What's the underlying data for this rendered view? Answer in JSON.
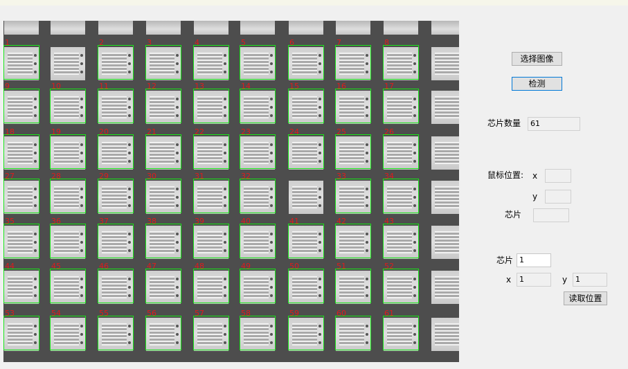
{
  "controls": {
    "select_image_label": "选择图像",
    "detect_label": "检测",
    "chip_count_label": "芯片数量",
    "chip_count_value": "61",
    "mouse_position_label": "鼠标位置:",
    "mouse_x_label": "x",
    "mouse_x_value": "",
    "mouse_y_label": "y",
    "mouse_y_value": "",
    "mouse_chip_label": "芯片",
    "mouse_chip_value": "",
    "query_chip_label": "芯片",
    "query_chip_value": "1",
    "read_x_label": "x",
    "read_x_value": "1",
    "read_y_label": "y",
    "read_y_value": "1",
    "read_position_label": "读取位置"
  },
  "detections": [
    {
      "label": "1",
      "row": 0,
      "col": 0
    },
    {
      "label": "2",
      "row": 0,
      "col": 2
    },
    {
      "label": "3",
      "row": 0,
      "col": 3
    },
    {
      "label": "4",
      "row": 0,
      "col": 4
    },
    {
      "label": "5",
      "row": 0,
      "col": 5
    },
    {
      "label": "6",
      "row": 0,
      "col": 6
    },
    {
      "label": "7",
      "row": 0,
      "col": 7
    },
    {
      "label": "8",
      "row": 0,
      "col": 8
    },
    {
      "label": "9",
      "row": 1,
      "col": 0
    },
    {
      "label": "10",
      "row": 1,
      "col": 1
    },
    {
      "label": "11",
      "row": 1,
      "col": 2
    },
    {
      "label": "12",
      "row": 1,
      "col": 3
    },
    {
      "label": "13",
      "row": 1,
      "col": 4
    },
    {
      "label": "14",
      "row": 1,
      "col": 5
    },
    {
      "label": "15",
      "row": 1,
      "col": 6
    },
    {
      "label": "16",
      "row": 1,
      "col": 7
    },
    {
      "label": "17",
      "row": 1,
      "col": 8
    },
    {
      "label": "18",
      "row": 2,
      "col": 0
    },
    {
      "label": "19",
      "row": 2,
      "col": 1
    },
    {
      "label": "20",
      "row": 2,
      "col": 2
    },
    {
      "label": "21",
      "row": 2,
      "col": 3
    },
    {
      "label": "22",
      "row": 2,
      "col": 4
    },
    {
      "label": "23",
      "row": 2,
      "col": 5
    },
    {
      "label": "24",
      "row": 2,
      "col": 6
    },
    {
      "label": "25",
      "row": 2,
      "col": 7
    },
    {
      "label": "26",
      "row": 2,
      "col": 8
    },
    {
      "label": "27",
      "row": 3,
      "col": 0
    },
    {
      "label": "28",
      "row": 3,
      "col": 1
    },
    {
      "label": "29",
      "row": 3,
      "col": 2
    },
    {
      "label": "30",
      "row": 3,
      "col": 3
    },
    {
      "label": "31",
      "row": 3,
      "col": 4
    },
    {
      "label": "32",
      "row": 3,
      "col": 5
    },
    {
      "label": "33",
      "row": 3,
      "col": 7
    },
    {
      "label": "34",
      "row": 3,
      "col": 8
    },
    {
      "label": "35",
      "row": 4,
      "col": 0
    },
    {
      "label": "36",
      "row": 4,
      "col": 1
    },
    {
      "label": "37",
      "row": 4,
      "col": 2
    },
    {
      "label": "38",
      "row": 4,
      "col": 3
    },
    {
      "label": "39",
      "row": 4,
      "col": 4
    },
    {
      "label": "40",
      "row": 4,
      "col": 5
    },
    {
      "label": "41",
      "row": 4,
      "col": 6
    },
    {
      "label": "42",
      "row": 4,
      "col": 7
    },
    {
      "label": "43",
      "row": 4,
      "col": 8
    },
    {
      "label": "44",
      "row": 5,
      "col": 0
    },
    {
      "label": "45",
      "row": 5,
      "col": 1
    },
    {
      "label": "46",
      "row": 5,
      "col": 2
    },
    {
      "label": "47",
      "row": 5,
      "col": 3
    },
    {
      "label": "48",
      "row": 5,
      "col": 4
    },
    {
      "label": "49",
      "row": 5,
      "col": 5
    },
    {
      "label": "50",
      "row": 5,
      "col": 6
    },
    {
      "label": "51",
      "row": 5,
      "col": 7
    },
    {
      "label": "52",
      "row": 5,
      "col": 8
    },
    {
      "label": "53",
      "row": 6,
      "col": 0
    },
    {
      "label": "54",
      "row": 6,
      "col": 1
    },
    {
      "label": "55",
      "row": 6,
      "col": 2
    },
    {
      "label": "56",
      "row": 6,
      "col": 3
    },
    {
      "label": "57",
      "row": 6,
      "col": 4
    },
    {
      "label": "58",
      "row": 6,
      "col": 5
    },
    {
      "label": "59",
      "row": 6,
      "col": 6
    },
    {
      "label": "60",
      "row": 6,
      "col": 7
    },
    {
      "label": "61",
      "row": 6,
      "col": 8
    }
  ]
}
